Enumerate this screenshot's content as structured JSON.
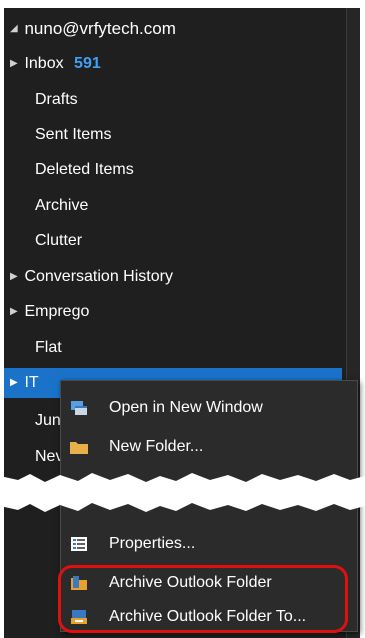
{
  "account": {
    "label": "nuno@vrfytech.com"
  },
  "folders": [
    {
      "label": "Inbox",
      "count": "591",
      "expandable": true
    },
    {
      "label": "Drafts"
    },
    {
      "label": "Sent Items"
    },
    {
      "label": "Deleted Items"
    },
    {
      "label": "Archive"
    },
    {
      "label": "Clutter"
    },
    {
      "label": "Conversation History",
      "expandable": true
    },
    {
      "label": "Emprego",
      "expandable": true
    },
    {
      "label": "Flat"
    },
    {
      "label": "IT",
      "expandable": true,
      "selected": true
    },
    {
      "label": "Jun"
    },
    {
      "label": "Nev"
    }
  ],
  "context_menu": {
    "items": [
      {
        "label": "Open in New Window",
        "icon": "new-window-icon"
      },
      {
        "label": "New Folder...",
        "icon": "folder-icon"
      },
      {
        "label": "Properties...",
        "icon": "properties-icon"
      },
      {
        "label": "Archive Outlook Folder",
        "icon": "archive-folder-icon"
      },
      {
        "label": "Archive Outlook Folder To...",
        "icon": "archive-to-icon"
      }
    ]
  },
  "colors": {
    "background": "#1f1f1f",
    "selected": "#1a73c9",
    "count": "#3fa1f5",
    "highlight": "#e01010"
  }
}
